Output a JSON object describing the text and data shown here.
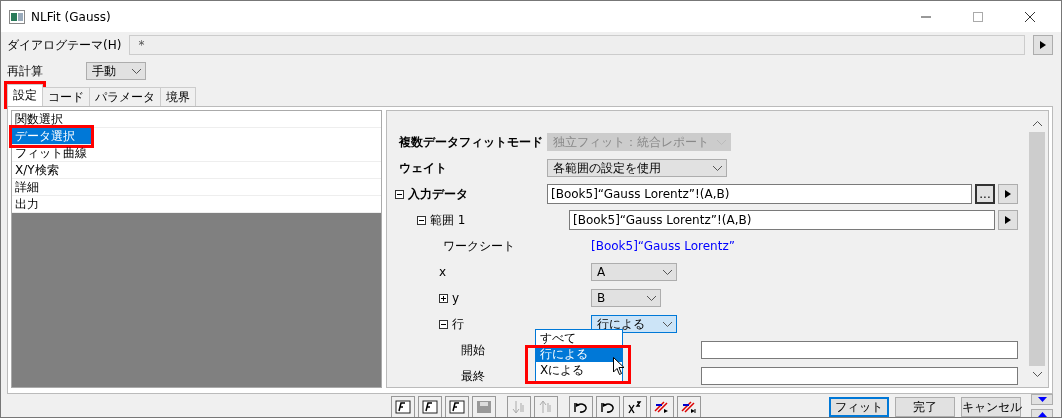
{
  "window": {
    "title": "NLFit (Gauss)"
  },
  "theme": {
    "label": "ダイアログテーマ(H)",
    "value": "*"
  },
  "recalc": {
    "label": "再計算",
    "value": "手動"
  },
  "tabs": [
    {
      "label": "設定",
      "selected": true,
      "annotated": true
    },
    {
      "label": "コード",
      "selected": false,
      "annotated": false
    },
    {
      "label": "パラメータ",
      "selected": false,
      "annotated": false
    },
    {
      "label": "境界",
      "selected": false,
      "annotated": false
    }
  ],
  "sidebar": {
    "items": [
      {
        "label": "関数選択",
        "selected": false,
        "annotated": false
      },
      {
        "label": "データ選択",
        "selected": true,
        "annotated": true
      },
      {
        "label": "フィット曲線",
        "selected": false,
        "annotated": false
      },
      {
        "label": "X/Y検索",
        "selected": false,
        "annotated": false
      },
      {
        "label": "詳細",
        "selected": false,
        "annotated": false
      },
      {
        "label": "出力",
        "selected": false,
        "annotated": false
      }
    ]
  },
  "settings": [
    {
      "kind": "combo",
      "label": "複数データフィットモード",
      "bold": true,
      "value": "独立フィット：統合レポート",
      "disabled": true
    },
    {
      "kind": "combo",
      "label": "ウェイト",
      "bold": true,
      "value": "各範囲の設定を使用",
      "disabled": false
    },
    {
      "kind": "range",
      "label": "入力データ",
      "bold": true,
      "expanded": true,
      "value": "[Book5]“Gauss Lorentz”!(A,B)",
      "browse": "..."
    },
    {
      "kind": "range",
      "label": "範囲 1",
      "bold": false,
      "expanded": true,
      "value": "[Book5]“Gauss Lorentz”!(A,B)"
    },
    {
      "kind": "link",
      "label": "ワークシート",
      "value": "[Book5]“Gauss Lorentz”"
    },
    {
      "kind": "combo",
      "label": "x",
      "bold": false,
      "value": "A",
      "disabled": false
    },
    {
      "kind": "combo",
      "label": "y",
      "bold": false,
      "expanded": false,
      "value": "B",
      "disabled": false
    },
    {
      "kind": "combo",
      "label": "行",
      "bold": false,
      "expanded": true,
      "value": "行による",
      "disabled": false,
      "focused": true
    },
    {
      "kind": "text",
      "label": "開始"
    },
    {
      "kind": "text",
      "label": "最終"
    }
  ],
  "dropdown": {
    "options": [
      {
        "label": "すべて",
        "selected": false
      },
      {
        "label": "行による",
        "selected": true
      },
      {
        "label": "Xによる",
        "selected": false
      }
    ]
  },
  "buttons": [
    {
      "label": "フィット",
      "default": true
    },
    {
      "label": "完了",
      "default": false
    },
    {
      "label": "キャンセル",
      "default": false
    }
  ]
}
